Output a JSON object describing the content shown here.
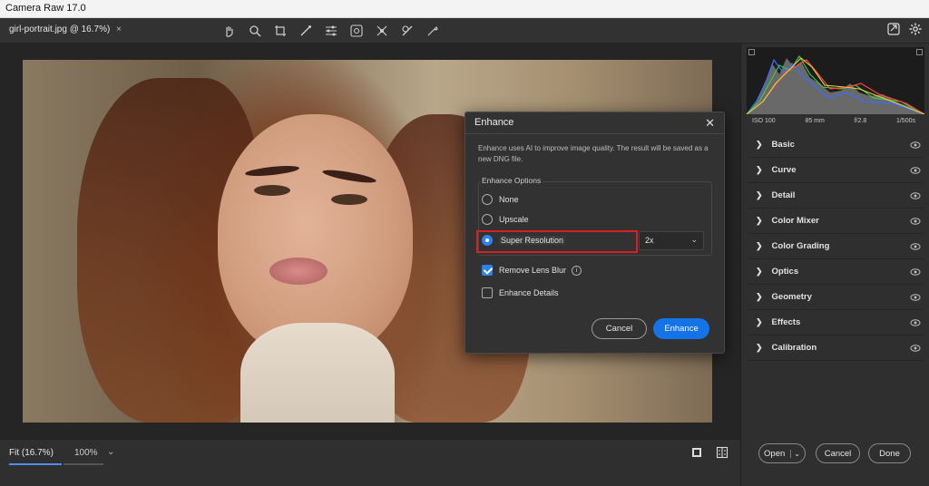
{
  "app": {
    "title": "Camera Raw 17.0"
  },
  "document": {
    "tab_label": "girl-portrait.jpg @ 16.7%)",
    "close_glyph": "×"
  },
  "toolbar": {
    "tools": [
      "hand-icon",
      "zoom-icon",
      "crop-icon",
      "brush-icon",
      "adjust-icon",
      "redeye-icon",
      "masking-icon",
      "heal-icon",
      "presets-icon"
    ],
    "right_icons": [
      "open-object-icon",
      "settings-icon"
    ]
  },
  "bottom": {
    "fit_label": "Fit (16.7%)",
    "zoom_label": "100%",
    "zoom_chevron": "⌄",
    "icons": [
      "filmstrip-icon",
      "compare-icon"
    ]
  },
  "histogram": {
    "iso": "ISO 100",
    "focal": "85 mm",
    "aperture": "f/2.8",
    "shutter": "1/500s"
  },
  "panels": [
    {
      "label": "Basic"
    },
    {
      "label": "Curve"
    },
    {
      "label": "Detail"
    },
    {
      "label": "Color Mixer"
    },
    {
      "label": "Color Grading"
    },
    {
      "label": "Optics"
    },
    {
      "label": "Geometry"
    },
    {
      "label": "Effects"
    },
    {
      "label": "Calibration"
    }
  ],
  "footer_buttons": {
    "open": "Open",
    "cancel": "Cancel",
    "done": "Done"
  },
  "dialog": {
    "title": "Enhance",
    "close_glyph": "✕",
    "description": "Enhance uses AI to improve image quality. The result will be saved as a new DNG file.",
    "options_legend": "Enhance Options",
    "options": [
      {
        "label": "None",
        "selected": false
      },
      {
        "label": "Upscale",
        "selected": false
      },
      {
        "label": "Super Resolution",
        "selected": true
      }
    ],
    "scale_value": "2x",
    "checkboxes": [
      {
        "label": "Remove Lens Blur",
        "checked": true
      },
      {
        "label": "Enhance Details",
        "checked": false
      }
    ],
    "cancel_label": "Cancel",
    "enhance_label": "Enhance",
    "accent": "#1473e6",
    "highlight": "#d81f26"
  }
}
